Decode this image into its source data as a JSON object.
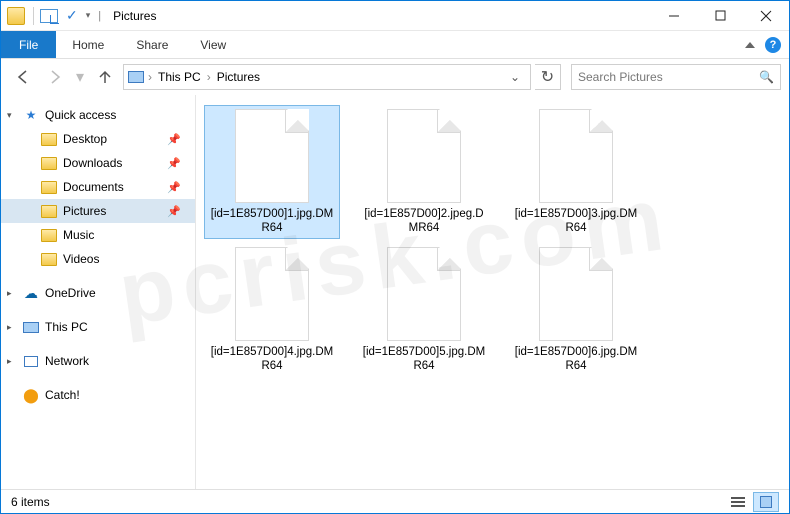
{
  "title": "Pictures",
  "ribbon": {
    "file": "File",
    "home": "Home",
    "share": "Share",
    "view": "View"
  },
  "breadcrumb": {
    "root": "This PC",
    "folder": "Pictures"
  },
  "search_placeholder": "Search Pictures",
  "sidebar": {
    "quick": "Quick access",
    "items": [
      "Desktop",
      "Downloads",
      "Documents",
      "Pictures",
      "Music",
      "Videos"
    ],
    "onedrive": "OneDrive",
    "thispc": "This PC",
    "network": "Network",
    "catch": "Catch!"
  },
  "files": [
    "[id=1E857D00]1.jpg.DMR64",
    "[id=1E857D00]2.jpeg.DMR64",
    "[id=1E857D00]3.jpg.DMR64",
    "[id=1E857D00]4.jpg.DMR64",
    "[id=1E857D00]5.jpg.DMR64",
    "[id=1E857D00]6.jpg.DMR64"
  ],
  "status": "6 items"
}
